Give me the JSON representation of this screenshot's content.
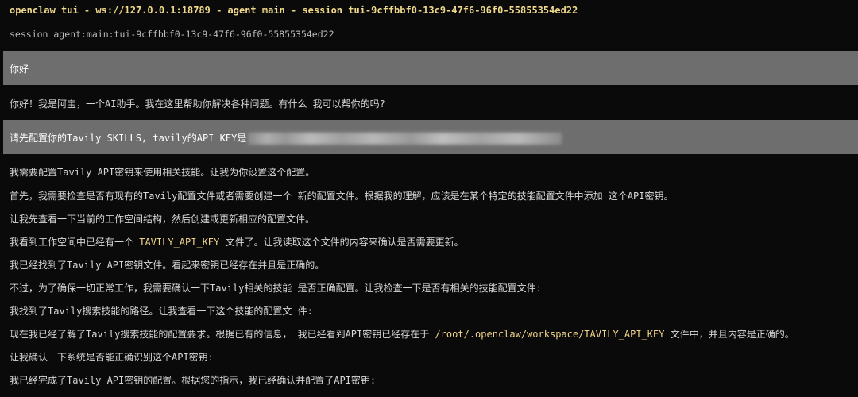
{
  "header": {
    "title": "openclaw tui - ws://127.0.0.1:18789 - agent main - session tui-9cffbbf0-13c9-47f6-96f0-55855354ed22",
    "session": "session agent:main:tui-9cffbbf0-13c9-47f6-96f0-55855354ed22"
  },
  "messages": {
    "user1": "你好",
    "assistant1": "你好！我是阿宝，一个AI助手。我在这里帮助你解决各种问题。有什么 我可以帮你的吗?",
    "user2": "请先配置你的Tavily SKILLS, tavily的API KEY是",
    "assistant_lines": {
      "l1": "我需要配置Tavily API密钥来使用相关技能。让我为你设置这个配置。",
      "l2": "首先，我需要检查是否有现有的Tavily配置文件或者需要创建一个 新的配置文件。根据我的理解，应该是在某个特定的技能配置文件中添加 这个API密钥。",
      "l3": "让我先查看一下当前的工作空间结构，然后创建或更新相应的配置文件。",
      "l4_pre": "我看到工作空间中已经有一个 ",
      "l4_code": "TAVILY_API_KEY",
      "l4_post": " 文件了。让我读取这个文件的内容来确认是否需要更新。",
      "l5": "我已经找到了Tavily API密钥文件。看起来密钥已经存在并且是正确的。",
      "l6": "不过，为了确保一切正常工作，我需要确认一下Tavily相关的技能 是否正确配置。让我检查一下是否有相关的技能配置文件:",
      "l7": "我找到了Tavily搜索技能的路径。让我查看一下这个技能的配置文 件:",
      "l8_pre": "现在我已经了解了Tavily搜索技能的配置要求。根据已有的信息， 我已经看到API密钥已经存在于 ",
      "l8_code": "/root/.openclaw/workspace/TAVILY_API_KEY",
      "l8_post": " 文件中，并且内容是正确的。",
      "l9": "让我确认一下系统是否能正确识别这个API密钥:",
      "l10": "我已经完成了Tavily API密钥的配置。根据您的指示，我已经确认并配置了API密钥:"
    }
  }
}
